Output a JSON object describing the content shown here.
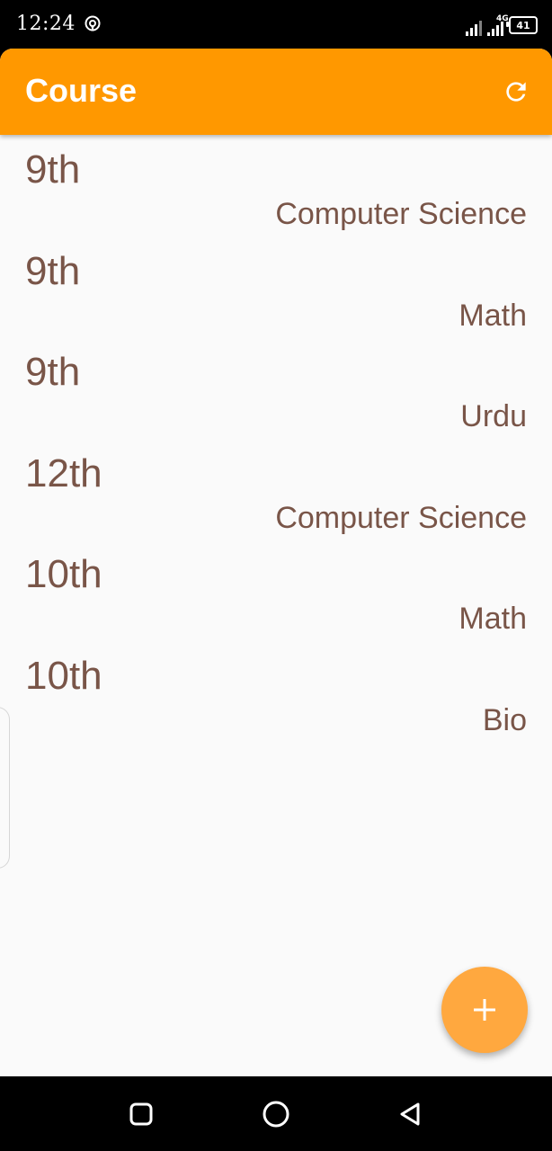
{
  "status_bar": {
    "time": "12:24",
    "network_type": "4G",
    "battery_level": "41",
    "icons": [
      "hotspot-icon",
      "signal-icon",
      "signal-4g-icon",
      "battery-icon"
    ]
  },
  "app_bar": {
    "title": "Course",
    "action_icon": "refresh-icon"
  },
  "courses": [
    {
      "class": "9th",
      "subject": "Computer Science"
    },
    {
      "class": "9th",
      "subject": "Math"
    },
    {
      "class": "9th",
      "subject": "Urdu"
    },
    {
      "class": "12th",
      "subject": "Computer Science"
    },
    {
      "class": "10th",
      "subject": "Math"
    },
    {
      "class": "10th",
      "subject": "Bio"
    }
  ],
  "fab": {
    "icon": "add-icon"
  },
  "nav_bar": {
    "icons": [
      "recents-icon",
      "home-icon",
      "back-icon"
    ]
  },
  "colors": {
    "app_bar": "#ff9800",
    "fab": "#ffa83f",
    "list_text": "#795548",
    "background": "#fafafa"
  }
}
